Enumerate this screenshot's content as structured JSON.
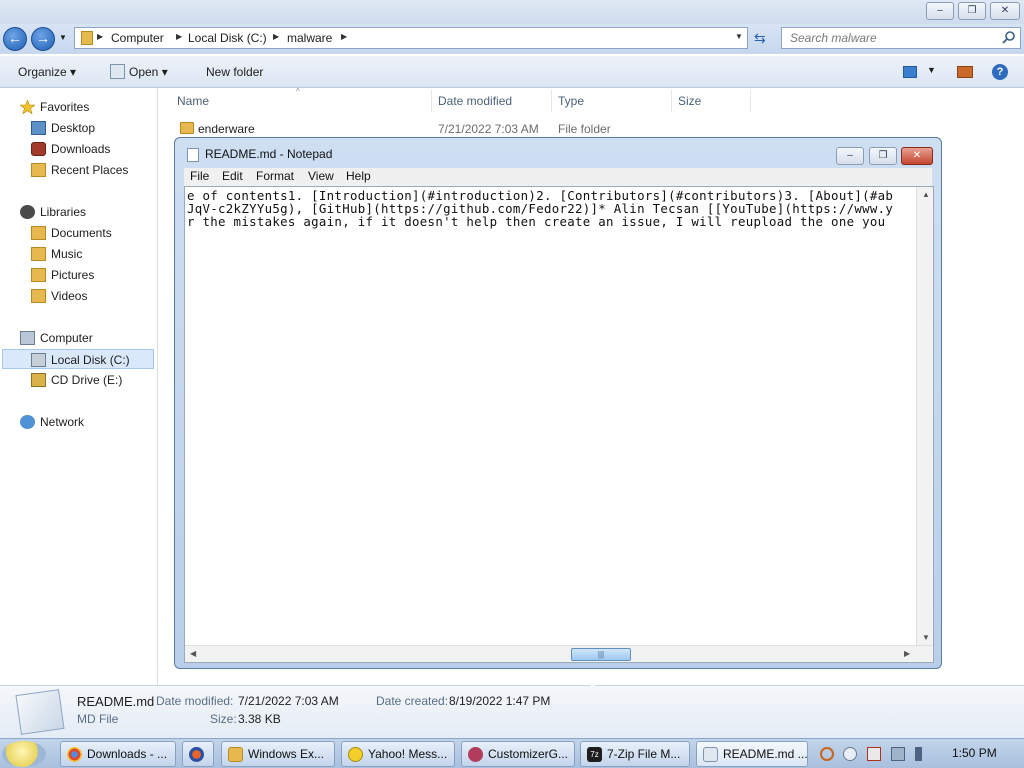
{
  "explorer": {
    "breadcrumb": [
      "Computer",
      "Local Disk (C:)",
      "malware"
    ],
    "search_placeholder": "Search malware",
    "toolbar": {
      "organize": "Organize",
      "open": "Open",
      "new_folder": "New folder"
    },
    "sidebar": {
      "favorites": "Favorites",
      "favorites_items": [
        "Desktop",
        "Downloads",
        "Recent Places"
      ],
      "libraries": "Libraries",
      "libraries_items": [
        "Documents",
        "Music",
        "Pictures",
        "Videos"
      ],
      "computer": "Computer",
      "computer_items": [
        "Local Disk (C:)",
        "CD Drive (E:)"
      ],
      "network": "Network",
      "selected": "Local Disk (C:)"
    },
    "columns": [
      "Name",
      "Date modified",
      "Type",
      "Size"
    ],
    "rows": [
      {
        "name": "enderware",
        "date": "7/21/2022 7:03 AM",
        "type": "File folder",
        "size": ""
      }
    ],
    "details": {
      "file_name": "README.md",
      "file_type": "MD File",
      "date_modified_label": "Date modified:",
      "date_modified": "7/21/2022 7:03 AM",
      "size_label": "Size:",
      "size": "3.38 KB",
      "date_created_label": "Date created:",
      "date_created": "8/19/2022 1:47 PM"
    }
  },
  "notepad": {
    "title": "README.md - Notepad",
    "menu": [
      "File",
      "Edit",
      "Format",
      "View",
      "Help"
    ],
    "lines": [
      "e of contents1. [Introduction](#introduction)2. [Contributors](#contributors)3. [About](#ab",
      "JqV-c2kZYYu5g), [GitHub](https://github.com/Fedor22)]* Alin Tecsan [[YouTube](https://www.y",
      "r the mistakes again, if it doesn't help then create an issue, I will reupload the one you"
    ]
  },
  "taskbar": {
    "tasks": [
      "Downloads - ...",
      "Windows Ex...",
      "Yahoo! Mess...",
      "CustomizerG...",
      "7-Zip File M...",
      "README.md ..."
    ],
    "clock": "1:50 PM"
  },
  "colors": {
    "selection": "#d9e8fb",
    "accent": "#1f5fb4"
  }
}
